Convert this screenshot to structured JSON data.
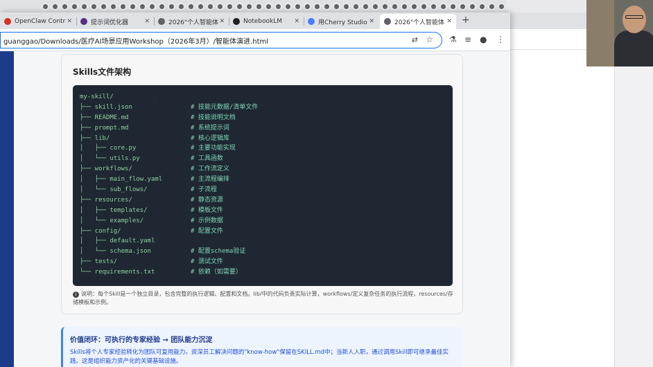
{
  "tabs": [
    {
      "label": "OpenClaw Contr",
      "fav_color": "#d93025"
    },
    {
      "label": "提示词优化器",
      "fav_color": "#5b2c83"
    },
    {
      "label": "2026\"个人智能体",
      "fav_color": "#5f6368"
    },
    {
      "label": "NotebookLM",
      "fav_color": "#202124"
    },
    {
      "label": "用Cherry Studio",
      "fav_color": "#4a7cff"
    },
    {
      "label": "2026\"个人智能体",
      "fav_color": "#5f6368"
    }
  ],
  "address": {
    "url": "guanggao/Downloads/医疗AI场景应用Workshop（2026年3月）/智能体演进.html"
  },
  "skills_card": {
    "title": "Skills文件架构",
    "lines": [
      {
        "tree": "my-skill/",
        "comment": ""
      },
      {
        "tree": "├── skill.json",
        "comment": "# 技能元数据/清单文件"
      },
      {
        "tree": "├── README.md",
        "comment": "# 技能说明文档"
      },
      {
        "tree": "├── prompt.md",
        "comment": "# 系统提示词"
      },
      {
        "tree": "├── lib/",
        "comment": "# 核心逻辑库"
      },
      {
        "tree": "│   ├── core.py",
        "comment": "# 主要功能实现"
      },
      {
        "tree": "│   └── utils.py",
        "comment": "# 工具函数"
      },
      {
        "tree": "├── workflows/",
        "comment": "# 工作流定义"
      },
      {
        "tree": "│   ├── main_flow.yaml",
        "comment": "# 主流程编排"
      },
      {
        "tree": "│   └── sub_flows/",
        "comment": "# 子流程"
      },
      {
        "tree": "├── resources/",
        "comment": "# 静态资源"
      },
      {
        "tree": "│   ├── templates/",
        "comment": "# 模板文件"
      },
      {
        "tree": "│   └── examples/",
        "comment": "# 示例数据"
      },
      {
        "tree": "├── config/",
        "comment": "# 配置文件"
      },
      {
        "tree": "│   ├── default.yaml",
        "comment": ""
      },
      {
        "tree": "│   └── schema.json",
        "comment": "# 配置schema验证"
      },
      {
        "tree": "├── tests/",
        "comment": "# 测试文件"
      },
      {
        "tree": "└── requirements.txt",
        "comment": "# 依赖（如需要）"
      }
    ],
    "note": "说明：每个Skill是一个独立目录，包含完整的执行逻辑、配置和文档。lib/中的代码负责实际计算，workflows/定义复杂任务的执行流程，resources/存储模板和示例。"
  },
  "value_card": {
    "title": "价值闭环：可执行的专家经验 → 团队能力沉淀",
    "text": "Skills将个人专家经验转化为团队可复用能力。资深员工解决问题的\"know-how\"保留在SKILL.md中；当新人入职，通过调用Skill即可继承最佳实践。这是组织能力资产化的关键基础设施。"
  },
  "colors": {
    "accent": "#1a73e8",
    "code_bg": "#1f2733",
    "value_text": "#1d4ed8",
    "sidebar": "#1e3a8a"
  }
}
